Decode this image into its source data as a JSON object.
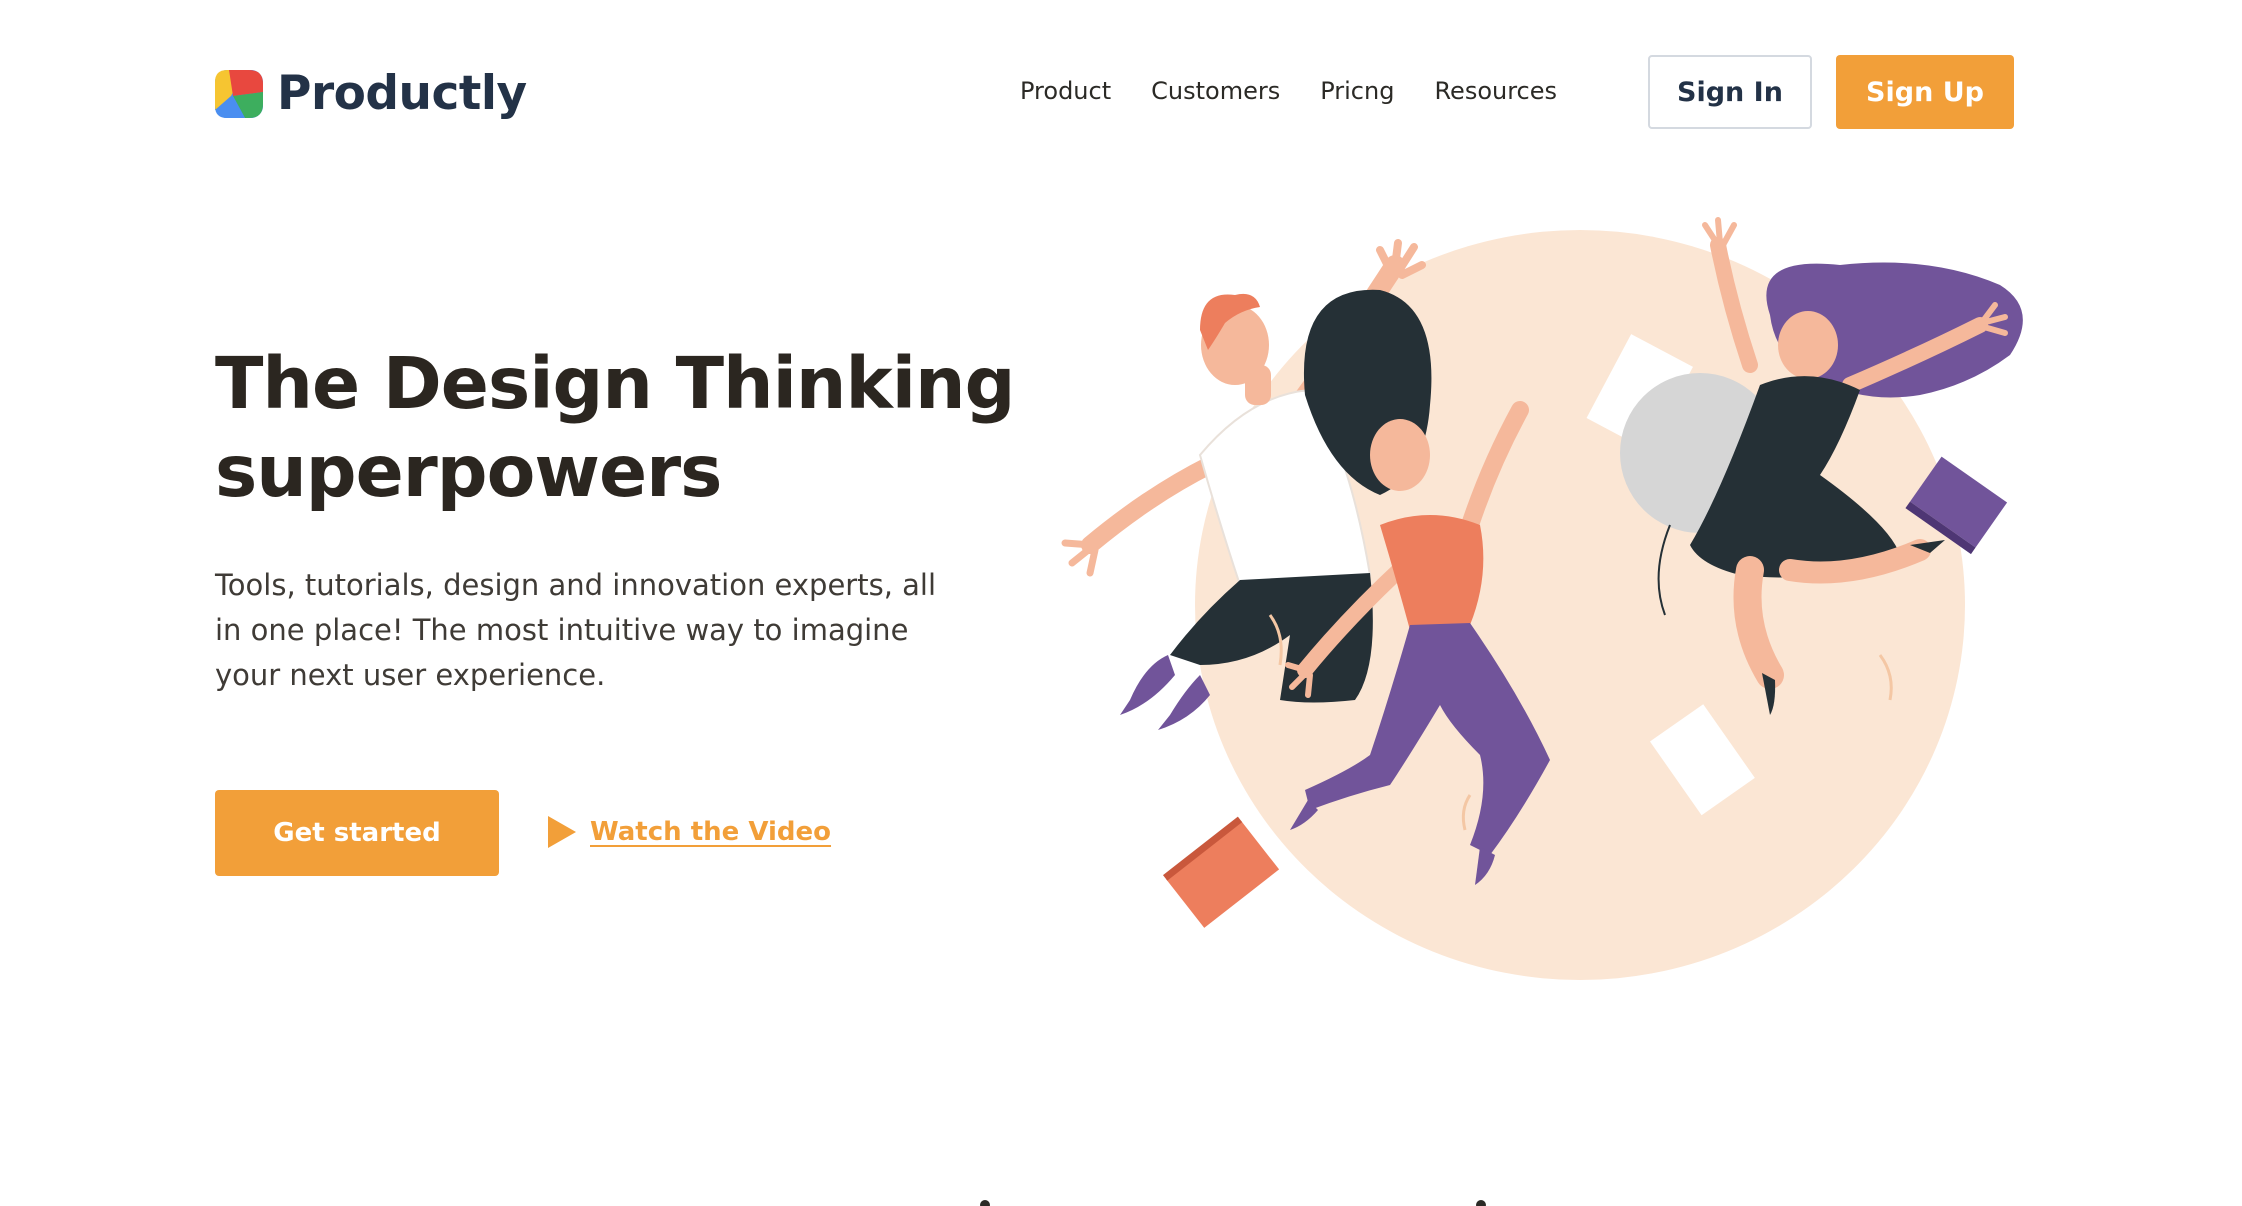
{
  "brand": {
    "name": "Productly",
    "logo_icon": "productly-logo-icon",
    "text_color": "#233247"
  },
  "nav": {
    "items": [
      {
        "label": "Product"
      },
      {
        "label": "Customers"
      },
      {
        "label": "Pricng"
      },
      {
        "label": "Resources"
      }
    ]
  },
  "auth": {
    "sign_in_label": "Sign In",
    "sign_up_label": "Sign Up"
  },
  "hero": {
    "title": "The Design Thinking superpowers",
    "subtitle": "Tools, tutorials, design and innovation experts, all in one place! The most intuitive way to imagine your next user experience.",
    "cta_label": "Get started",
    "video_label": "Watch the Video",
    "video_icon": "play-icon",
    "illustration": "jumping-people-illustration"
  },
  "colors": {
    "accent": "#f29f39",
    "heading": "#2b2620",
    "body_text": "#3f3b36",
    "circle_bg": "#fbe6d4",
    "purple": "#71549a",
    "dark": "#253036",
    "coral": "#ed7e5d"
  }
}
